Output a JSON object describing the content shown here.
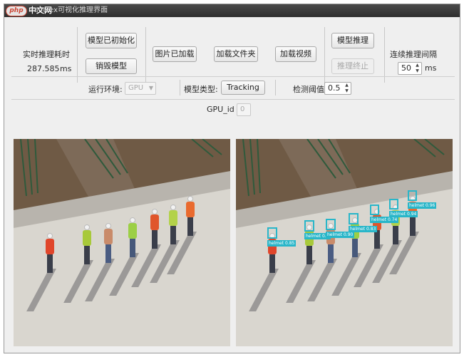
{
  "window": {
    "title": "Paddlex可视化推理界面"
  },
  "watermark": {
    "badge": "php",
    "text": "中文网"
  },
  "stats": {
    "label": "实时推理耗时",
    "value": "287.585",
    "unit": "ms"
  },
  "buttons": {
    "model_initialized": "模型已初始化",
    "destroy_model": "销毁模型",
    "image_loaded": "图片已加载",
    "load_folder": "加载文件夹",
    "load_video": "加载视频",
    "model_infer": "模型推理",
    "stop_infer": "推理终止"
  },
  "interval": {
    "label": "连续推理间隔",
    "value": "50",
    "unit": "ms"
  },
  "env": {
    "label": "运行环境:",
    "value": "GPU"
  },
  "model_type": {
    "label": "模型类型:",
    "value": "Tracking"
  },
  "threshold": {
    "label": "检测阈值",
    "value": "0.5"
  },
  "gpu": {
    "label": "GPU_id",
    "value": "0"
  },
  "detections": [
    {
      "label": "helmet",
      "score": "0.85"
    },
    {
      "label": "helmet",
      "score": "0.9"
    },
    {
      "label": "helmet",
      "score": "0.90"
    },
    {
      "label": "helmet",
      "score": "0.83"
    },
    {
      "label": "helmet",
      "score": "0.74"
    },
    {
      "label": "helmet",
      "score": "0.94"
    },
    {
      "label": "helmet",
      "score": "0.94"
    },
    {
      "label": "helmet",
      "score": "0.96"
    }
  ]
}
